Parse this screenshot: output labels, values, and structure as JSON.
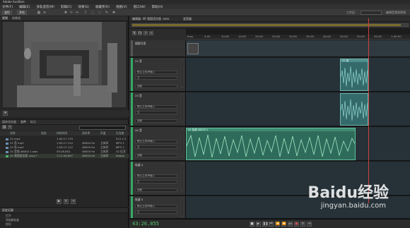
{
  "window": {
    "title": "Adobe Audition"
  },
  "menu": [
    "文件(F)",
    "编辑(E)",
    "多轨混音(M)",
    "剪辑(C)",
    "效果(S)",
    "收藏夹(R)",
    "视图(V)",
    "窗口(W)",
    "帮助(H)"
  ],
  "toolbar": {
    "waveform_label": "波形",
    "multitrack_label": "多轨"
  },
  "workspace": {
    "label": "工作区：",
    "value": "编辑音频到视频"
  },
  "preview": {
    "tabs": [
      "视频",
      "效果组"
    ]
  },
  "files": {
    "tabs": [
      "媒体浏览器",
      "文件",
      "标记"
    ],
    "columns": [
      "名称",
      "状态",
      "持续时间",
      "采样率",
      "声道",
      "位深度"
    ],
    "rows": [
      {
        "name": "22.mp4",
        "duration": "1:05:17.179",
        "rate": "",
        "channels": "",
        "depth": "512 x 3"
      },
      {
        "name": "22 音.mp3",
        "duration": "1:05:17.112",
        "rate": "48000 Hz",
        "channels": "立体声",
        "depth": "MP3 1"
      },
      {
        "name": "23 音.mp3",
        "duration": "1:05:17.112",
        "rate": "48000 Hz",
        "channels": "立体声",
        "depth": "MP3 1"
      },
      {
        "name": "24 音频 48000 1.wav",
        "duration": "59:26.802",
        "rate": "48000 Hz",
        "channels": "立体声",
        "depth": "32 位浮"
      },
      {
        "name": "49 我国语言版 .sesx *",
        "duration": "1:11:46.897",
        "rate": "48000 Hz",
        "channels": "立体声",
        "depth": "Adobe"
      }
    ]
  },
  "history": {
    "tab": "历史记录",
    "items": [
      "打开",
      "添加新轨道",
      "剪切"
    ]
  },
  "editor": {
    "tab": "编辑器: 49 我国语言版 .sesx",
    "tab2": "混音器",
    "ruler": [
      "hms",
      "5:00",
      "10:00",
      "15:00",
      "20:00",
      "25:00",
      "30:00",
      "35:00",
      "40:00",
      "45:00",
      "50:00",
      "55:00",
      "1:00:00"
    ],
    "video_track": "视频引用",
    "tracks": [
      {
        "name": "22 音",
        "input": "默认立体声输入",
        "output": "主",
        "read": "读取",
        "clip": "22 音"
      },
      {
        "name": "23 音",
        "input": "默认立体声输入",
        "output": "主",
        "read": "读取",
        "clip": ""
      },
      {
        "name": "44 音",
        "input": "默认立体声输入",
        "output": "主",
        "read": "读取",
        "clip": "44 音频 48000 1"
      },
      {
        "name": "轨道 4",
        "input": "默认立体声输入",
        "output": "主",
        "read": "读取",
        "clip": ""
      },
      {
        "name": "轨道 5",
        "input": "默认立体声输入",
        "output": "主",
        "read": "读取",
        "clip": ""
      }
    ]
  },
  "transport": {
    "timecode": "43:26.855"
  },
  "watermark": {
    "text": "Baidu经验",
    "url": "jingyan.baidu.com"
  },
  "colors": {
    "accent": "#55c96b",
    "playhead": "#d04040",
    "clip": "#356a6a",
    "track_bg": "#263238"
  }
}
